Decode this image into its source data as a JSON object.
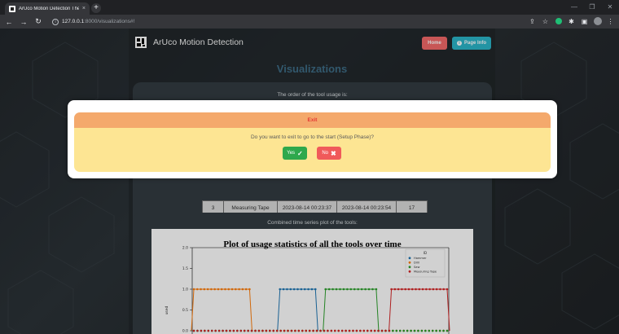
{
  "browser": {
    "tab_title": "ArUco Motion Detection Thesis",
    "tab_close": "×",
    "new_tab": "+",
    "url_host": "127.0.0.1",
    "url_path": ":8000/visualizations#!",
    "window_controls": [
      "—",
      "❐",
      "✕"
    ]
  },
  "header": {
    "brand": "ArUco Motion Detection",
    "home_button": "Home",
    "page_info_button": "Page Info",
    "page_info_icon": "i"
  },
  "main": {
    "title": "Visualizations",
    "order_caption": "The order of the tool usage is:",
    "table_rows": [
      {
        "num": "3",
        "tool": "Measuring Tape",
        "start": "2023-08-14 00:23:37",
        "end": "2023-08-14 00:23:54",
        "duration": "17"
      }
    ],
    "plot_caption": "Combined time series plot of the tools:"
  },
  "modal": {
    "header": "Exit",
    "message": "Do you want to exit to go to the start (Setup Phase)?",
    "yes_label": "Yes",
    "no_label": "No"
  },
  "chart_data": {
    "type": "line",
    "title": "Plot of usage statistics of all the tools over time",
    "ylabel": "used",
    "yticks": [
      "0.0",
      "0.5",
      "1.0",
      "1.5",
      "2.0"
    ],
    "ylim": [
      0,
      2.0
    ],
    "legend_title": "ID",
    "legend_position": "top-right",
    "series": [
      {
        "name": "Hammer",
        "color": "#1f77b4",
        "segments": [
          {
            "from": 0.34,
            "to": 0.48,
            "value": 1
          }
        ]
      },
      {
        "name": "Drill",
        "color": "#ff7f0e",
        "segments": [
          {
            "from": 0.0,
            "to": 0.22,
            "value": 1
          }
        ]
      },
      {
        "name": "Saw",
        "color": "#2ca02c",
        "segments": [
          {
            "from": 0.52,
            "to": 0.72,
            "value": 1
          }
        ]
      },
      {
        "name": "Measuring Tape",
        "color": "#d62728",
        "segments": [
          {
            "from": 0.78,
            "to": 1.0,
            "value": 1
          }
        ]
      }
    ],
    "grid": false
  },
  "colors": {
    "accent_title": "#3d6c86",
    "home": "#f56a6a",
    "page_info": "#2bb5c9",
    "modal_header": "#f4a96c",
    "modal_body": "#fde593",
    "yes": "#2ea84c",
    "no": "#f05a5a"
  }
}
